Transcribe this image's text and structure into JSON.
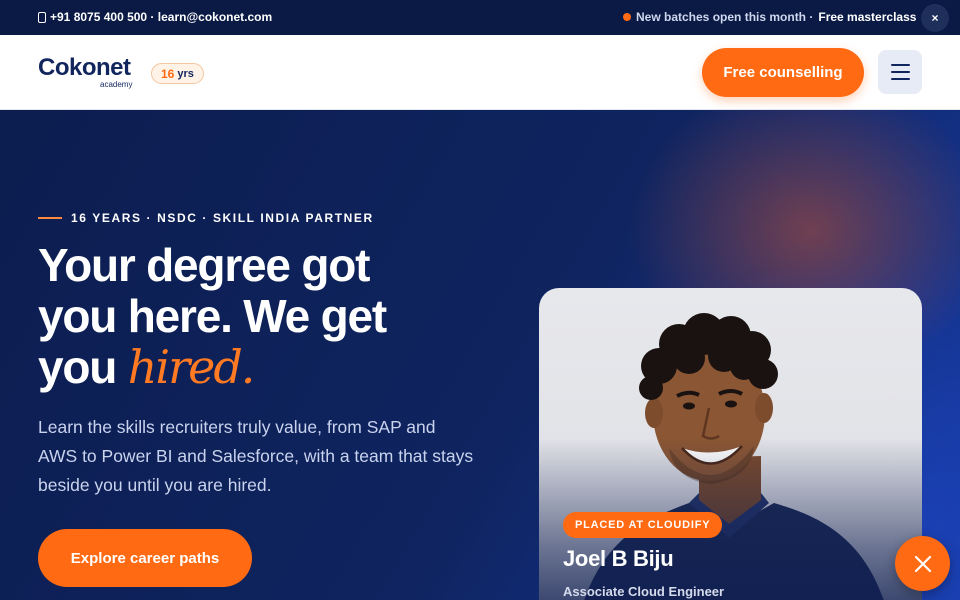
{
  "topbar": {
    "contact": "+91 8075 400 500 · learn@cokonet.com",
    "notice_text": "New batches open this month ·",
    "notice_strong": "Free masterclass",
    "close_label": "×"
  },
  "header": {
    "brand": "Cokonet",
    "brand_sub": "academy",
    "years_num": "16",
    "years_label": "yrs",
    "cta_label": "Free counselling"
  },
  "hero": {
    "eyebrow": "16 YEARS · NSDC · SKILL INDIA PARTNER",
    "headline_line1": "Your degree got",
    "headline_line2": "you here. We get",
    "headline_line3_prefix": "you",
    "headline_accent": "hired.",
    "lead": "Learn the skills recruiters truly value, from SAP and AWS to Power BI and Salesforce, with a team that stays beside you until you are hired.",
    "cta_label": "Explore career paths"
  },
  "testimonial": {
    "badge": "PLACED AT CLOUDIFY",
    "name": "Joel B Biju",
    "role": "Associate Cloud Engineer"
  },
  "colors": {
    "accent": "#ff6a13",
    "navy": "#12265e",
    "hero_bg": "#0f2460"
  },
  "icons": {
    "phone": "phone-icon",
    "close": "close-icon",
    "menu": "hamburger-menu-icon"
  }
}
